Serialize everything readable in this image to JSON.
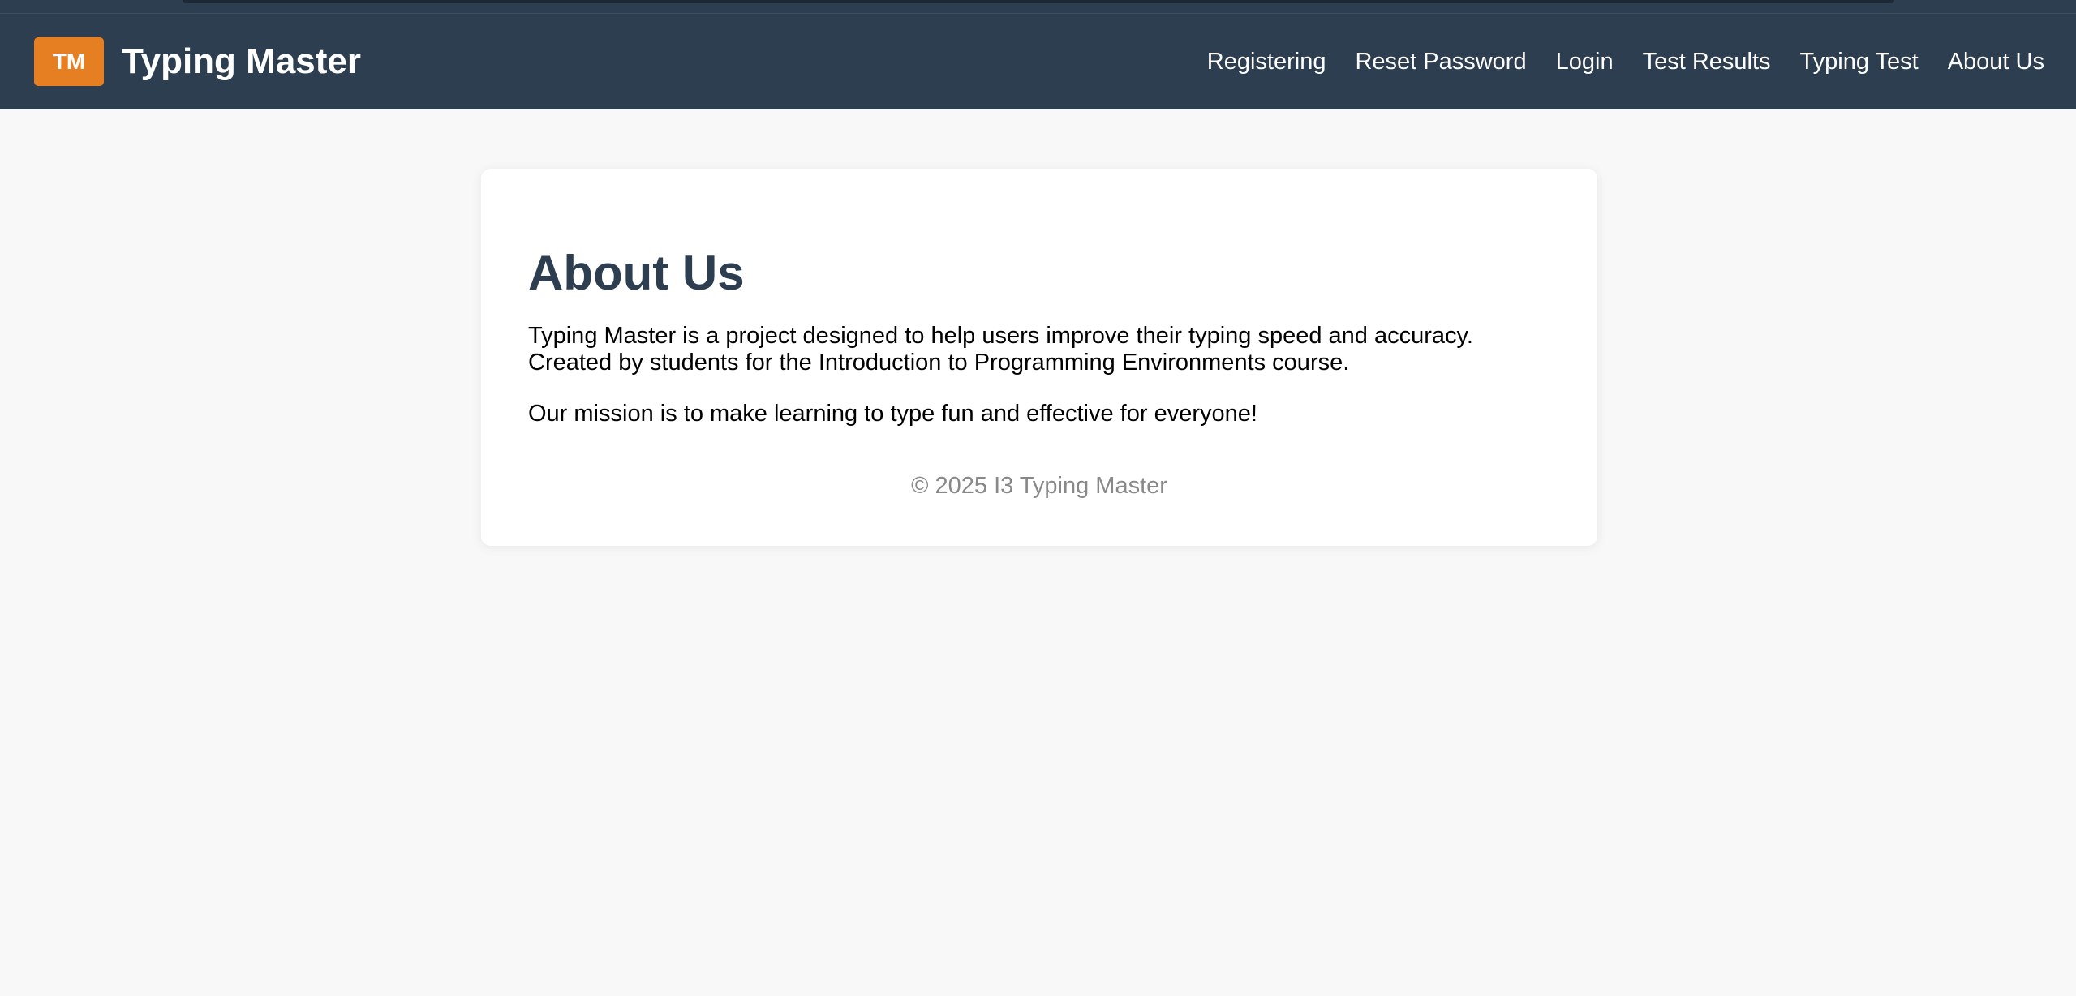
{
  "header": {
    "logo_text": "TM",
    "brand": "Typing Master",
    "nav": [
      {
        "label": "Registering"
      },
      {
        "label": "Reset Password"
      },
      {
        "label": "Login"
      },
      {
        "label": "Test Results"
      },
      {
        "label": "Typing Test"
      },
      {
        "label": "About Us"
      }
    ]
  },
  "main": {
    "title": "About Us",
    "paragraph1_line1": "Typing Master is a project designed to help users improve their typing speed and accuracy.",
    "paragraph1_line2": "Created by students for the Introduction to Programming Environments course.",
    "paragraph2": "Our mission is to make learning to type fun and effective for everyone!",
    "footer": "© 2025 I3 Typing Master"
  },
  "colors": {
    "navbar": "#2c3e50",
    "accent": "#e67e22",
    "background": "#f8f8f8",
    "heading": "#2c3e50",
    "footer_text": "#888888"
  }
}
